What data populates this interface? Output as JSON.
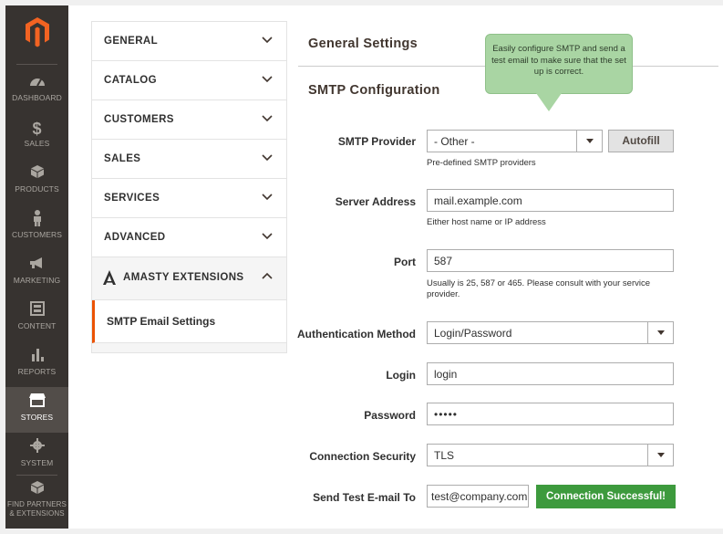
{
  "sidebar": {
    "items": [
      {
        "label": "DASHBOARD",
        "icon": "dashboard-icon"
      },
      {
        "label": "SALES",
        "icon": "dollar-icon"
      },
      {
        "label": "PRODUCTS",
        "icon": "cube-icon"
      },
      {
        "label": "CUSTOMERS",
        "icon": "person-icon"
      },
      {
        "label": "MARKETING",
        "icon": "megaphone-icon"
      },
      {
        "label": "CONTENT",
        "icon": "layout-icon"
      },
      {
        "label": "REPORTS",
        "icon": "bar-chart-icon"
      },
      {
        "label": "STORES",
        "icon": "store-icon"
      },
      {
        "label": "SYSTEM",
        "icon": "gear-icon"
      },
      {
        "label": "FIND PARTNERS & EXTENSIONS",
        "icon": "box-icon"
      }
    ],
    "active": "STORES"
  },
  "tabs": {
    "items": [
      "GENERAL",
      "CATALOG",
      "CUSTOMERS",
      "SALES",
      "SERVICES",
      "ADVANCED"
    ],
    "amasty_label": "AMASTY EXTENSIONS",
    "sub_item": "SMTP Email Settings"
  },
  "main": {
    "page_title": "General Settings",
    "section_title": "SMTP Configuration",
    "tooltip": "Easily configure SMTP and send a test email to make sure that the set up is correct."
  },
  "form": {
    "smtp_provider": {
      "label": "SMTP Provider",
      "value": "- Other -",
      "note": "Pre-defined SMTP providers",
      "button": "Autofill"
    },
    "server_address": {
      "label": "Server Address",
      "value": "mail.example.com",
      "note": "Either host name or IP address"
    },
    "port": {
      "label": "Port",
      "value": "587",
      "note": "Usually is 25, 587 or 465. Please consult with your service provider."
    },
    "auth_method": {
      "label": "Authentication Method",
      "value": "Login/Password"
    },
    "login": {
      "label": "Login",
      "value": "login"
    },
    "password": {
      "label": "Password",
      "value": "•••••"
    },
    "connection_security": {
      "label": "Connection Security",
      "value": "TLS"
    },
    "send_test": {
      "label": "Send Test E-mail To",
      "value": "test@company.com",
      "button": "Connection Successful!"
    }
  },
  "colors": {
    "accent": "#eb5202",
    "success": "#3d9a3d",
    "sidebar": "#373330",
    "tooltip": "#a9d5a3"
  }
}
